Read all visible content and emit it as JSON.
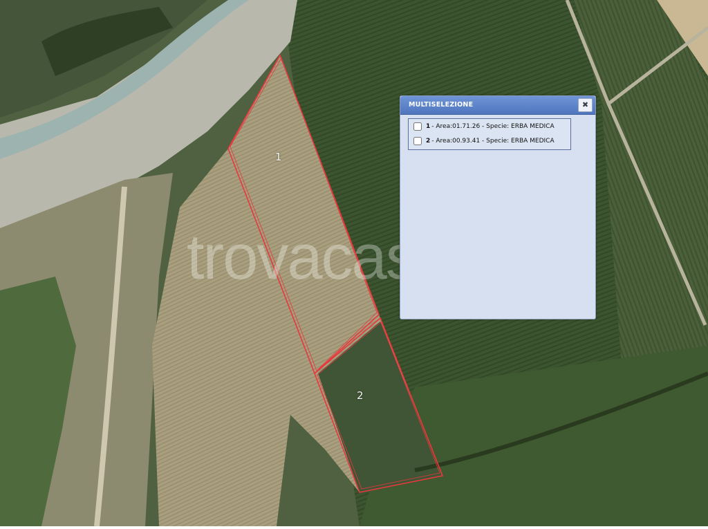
{
  "map": {
    "watermark": "trovacasa",
    "parcels": [
      {
        "label": "1",
        "color": "#e8383d"
      },
      {
        "label": "2",
        "color": "#e8383d"
      }
    ]
  },
  "dialog": {
    "title": "MULTISELEZIONE",
    "close_icon": "close-icon",
    "items": [
      {
        "number": "1",
        "text": " - Area:01.71.26 - Specie: ERBA MEDICA",
        "checked": false
      },
      {
        "number": "2",
        "text": " - Area:00.93.41 - Specie: ERBA MEDICA",
        "checked": false
      }
    ]
  }
}
